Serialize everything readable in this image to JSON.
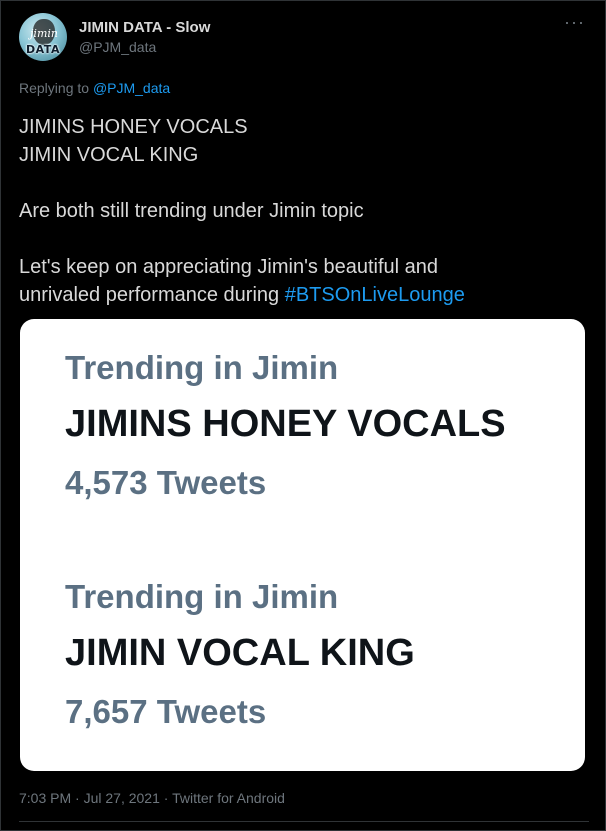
{
  "author": {
    "display_name": "JIMIN DATA - Slow",
    "handle": "@PJM_data",
    "avatar_text": "DATA",
    "avatar_script": "jimin"
  },
  "more_label": "···",
  "reply": {
    "prefix": "Replying to ",
    "mention": "@PJM_data"
  },
  "tweet": {
    "line1": "JIMINS HONEY VOCALS",
    "line2": "JIMIN VOCAL KING",
    "line3": "Are both still trending under Jimin topic",
    "line4": "Let's keep on appreciating Jimin's beautiful and",
    "line5_prefix": "unrivaled performance during ",
    "hashtag": "#BTSOnLiveLounge"
  },
  "media": {
    "trends": [
      {
        "topic": "Trending in Jimin",
        "title": "JIMINS HONEY VOCALS",
        "count": "4,573 Tweets"
      },
      {
        "topic": "Trending in Jimin",
        "title": "JIMIN VOCAL KING",
        "count": "7,657 Tweets"
      }
    ]
  },
  "meta": {
    "time": "7:03 PM",
    "date": "Jul 27, 2021",
    "source": "Twitter for Android",
    "separator": " · "
  },
  "colors": {
    "background": "#000000",
    "text": "#d9d9d9",
    "secondary": "#6e767d",
    "link": "#1d9bf0",
    "trend_gray": "#5b7083",
    "trend_dark": "#0f1419"
  }
}
